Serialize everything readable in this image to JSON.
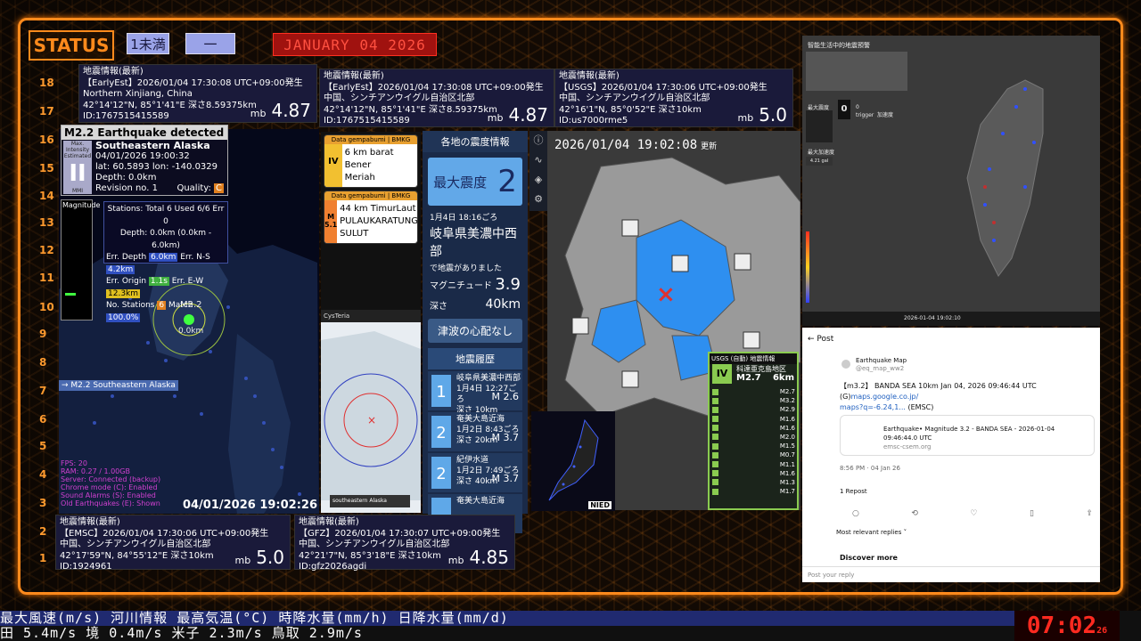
{
  "header": {
    "status": "STATUS",
    "badge1": "1未満",
    "badge2": "一",
    "date": "JANUARY 04  2026"
  },
  "scale": [
    "18",
    "17",
    "16",
    "15",
    "14",
    "13",
    "12",
    "11",
    "10",
    "9",
    "8",
    "7",
    "6",
    "5",
    "4",
    "3",
    "2",
    "1"
  ],
  "info_cards": [
    {
      "title": "地震情報(最新)",
      "line1": "【EarlyEst】2026/01/04  17:30:08  UTC+09:00発生",
      "line2": "Northern Xinjiang, China",
      "line3": "42°14'12\"N, 85°1'41\"E  深さ8.59375km",
      "line4": "ID:1767515415589",
      "mb": "mb",
      "mag": "4.87"
    },
    {
      "title": "地震情報(最新)",
      "line1": "【EarlyEst】2026/01/04  17:30:08  UTC+09:00発生",
      "line2": "中国、シンチアンウイグル自治区北部",
      "line3": "42°14'12\"N, 85°1'41\"E  深さ8.59375km",
      "line4": "ID:1767515415589",
      "mb": "mb",
      "mag": "4.87"
    },
    {
      "title": "地震情報(最新)",
      "line1": "【USGS】2026/01/04  17:30:06  UTC+09:00発生",
      "line2": "中国、シンチアンウイグル自治区北部",
      "line3": "42°16'1\"N, 85°0'52\"E  深さ10km",
      "line4": "ID:us7000rme5",
      "mb": "mb",
      "mag": "5.0"
    },
    {
      "title": "地震情報(最新)",
      "line1": "【EMSC】2026/01/04  17:30:06  UTC+09:00発生",
      "line2": "中国、シンチアンウイグル自治区北部",
      "line3": "42°17'59\"N, 84°55'12\"E  深さ10km",
      "line4": "ID:1924961",
      "mb": "mb",
      "mag": "5.0"
    },
    {
      "title": "地震情報(最新)",
      "line1": "【GFZ】2026/01/04  17:30:07  UTC+09:00発生",
      "line2": "中国、シンチアンウイグル自治区北部",
      "line3": "42°21'7\"N, 85°3'18\"E  深さ10km",
      "line4": "ID:gfz2026agdi",
      "mb": "mb",
      "mag": "4.85"
    }
  ],
  "eew": {
    "title": "M2.2 Earthquake detected",
    "int_label": "Max. Intensity Estimated",
    "int": "II",
    "mmi": "MMI",
    "region": "Southeastern Alaska",
    "time": "04/01/2026 19:00:32",
    "lat": "lat: 60.5893 lon: -140.0329",
    "depth": "Depth: 0.0km",
    "rev": "Revision no. 1",
    "quality": "Quality:",
    "quality_val": "C",
    "mag_title": "Magnitude"
  },
  "stats": {
    "line1": "Stations: Total 6 Used 6/6 Err 0",
    "line2": "Depth: 0.0km (0.0km - 6.0km)",
    "errd": "Err. Depth",
    "errd_v": "6.0km",
    "errns": "Err. N-S",
    "errns_v": "4.2km",
    "erro": "Err. Origin",
    "erro_v": "1.1s",
    "errew": "Err. E-W",
    "errew_v": "12.3km",
    "nst": "No. Stations",
    "nst_v": "6",
    "match": "Match",
    "match_v": "100.0%"
  },
  "world": {
    "marker": "M2.2",
    "depth": "0.0km",
    "tag": "→ M2.2 Southeastern Alaska",
    "time": "04/01/2026 19:02:26",
    "legend": [
      "FPS: 20",
      "RAM: 0.27 / 1.00GB",
      "Server: Connected (backup)",
      "Chrome mode (C): Enabled",
      "Sound Alarms (S): Enabled",
      "Old Earthquakes (E): Shown"
    ]
  },
  "bmkg": [
    {
      "hd": "Data gempabumi | BMKG",
      "lvl": "IV",
      "txt1": "6 km barat Bener",
      "txt2": "Meriah",
      "small": "Intensitas maks"
    },
    {
      "hd": "Data gempabumi | BMKG",
      "lvl": "M 5.1",
      "txt1": "44 km TimurLaut",
      "txt2": "PULAUKARATUNG-",
      "txt3": "SULUT"
    }
  ],
  "jp": {
    "title": "各地の震度情報",
    "max_label": "最大震度",
    "max": "2",
    "when": "1月4日 18:16ごろ",
    "where": "岐阜県美濃中西部",
    "had": "で地震がありました",
    "mag_label": "マグニチュード",
    "mag": "3.9",
    "depth_label": "深さ",
    "depth": "40km",
    "tsunami": "津波の心配なし",
    "hist_title": "地震履歴",
    "hist": [
      {
        "sc": "1",
        "place": "岐阜県美濃中西部",
        "date": "1月4日 12:27ごろ",
        "dep": "深さ 10km",
        "m": "M 2.6"
      },
      {
        "sc": "2",
        "place": "奄美大島近海",
        "date": "1月2日 8:43ごろ",
        "dep": "深さ 20km",
        "m": "M 3.7"
      },
      {
        "sc": "2",
        "place": "紀伊水道",
        "date": "1月2日 7:49ごろ",
        "dep": "深さ 40km",
        "m": "M 3.7"
      },
      {
        "sc": "",
        "place": "奄美大島近海",
        "date": "",
        "dep": "",
        "m": ""
      }
    ]
  },
  "shindo": {
    "time": "2026/01/04  19:02:08",
    "upd": "更新"
  },
  "usgs": {
    "hd": "USGS (自動) 地震情報",
    "iv": "IV",
    "place": "科達亜克島地区",
    "mag": "M2.7",
    "depth": "6km",
    "rows": [
      {
        "m": "M2.7"
      },
      {
        "m": "M3.2"
      },
      {
        "m": "M2.9"
      },
      {
        "m": "M1.6"
      },
      {
        "m": "M1.6"
      },
      {
        "m": "M2.0"
      },
      {
        "m": "M1.5"
      },
      {
        "m": "M0.7"
      },
      {
        "m": "M1.1"
      },
      {
        "m": "M1.6"
      },
      {
        "m": "M1.3"
      },
      {
        "m": "M1.7"
      }
    ]
  },
  "cystema": {
    "app": "CysTeria",
    "region": "southeastern Alaska"
  },
  "nied": {
    "logo": "NIED"
  },
  "taiwan": {
    "title": "智能生活中的地震預警",
    "zero": "0",
    "max_label": "最大震度",
    "trigger": "trigger",
    "num": "0",
    "hz": "加速度",
    "peak": "最大加速度",
    "val": "4.21 gal",
    "time": "2026-01-04 19:02:10"
  },
  "post": {
    "header": "Post",
    "name": "Earthquake Map",
    "handle": "@eq_map_ww2",
    "body1": "【m3.2】 BANDA SEA 10km Jan 04, 2026 09:46:44 UTC (G)",
    "link": "maps.google.co.jp/",
    "body2": "maps?q=-6.24,1...",
    "emsc": "(EMSC)",
    "card": "Earthquake• Magnitude 3.2 - BANDA SEA - 2026-01-04 09:46:44.0 UTC",
    "card2": "emsc-csem.org",
    "time": "8:56 PM · 04 Jan 26",
    "repost": "1 Repost",
    "replies": "Most relevant replies ˅",
    "discover": "Discover more",
    "reply": "Post your reply"
  },
  "ticker": {
    "top": "最大風速(m/s)  河川情報      最高気温(°C)     時降水量(mm/h)   日降水量(mm/d)",
    "bot": "田 5.4m/s    境 0.4m/s     米子 2.3m/s      鳥取 2.9m/s"
  },
  "clock": {
    "time": "07:02",
    "sec": "26"
  }
}
